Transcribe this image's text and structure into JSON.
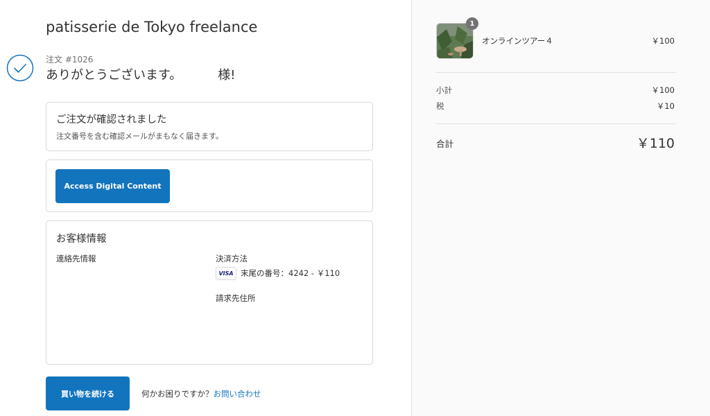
{
  "shop": {
    "name": "patisserie de Tokyo freelance"
  },
  "order": {
    "number_label": "注文 #1026",
    "thanks_prefix": "ありがとうございます。",
    "thanks_suffix": "様!"
  },
  "confirmation": {
    "title": "ご注文が確認されました",
    "subtitle": "注文番号を含む確認メールがまもなく届きます。"
  },
  "digital": {
    "button_label": "Access Digital Content"
  },
  "customer": {
    "title": "お客様情報",
    "contact_label": "連絡先情報",
    "payment_label": "決済方法",
    "card_brand": "VISA",
    "card_text": "末尾の番号：4242 - ￥110",
    "billing_label": "請求先住所"
  },
  "footer": {
    "continue_label": "買い物を続ける",
    "help_text": "何かお困りですか？",
    "contact_link": "お問い合わせ"
  },
  "summary": {
    "item": {
      "name": "オンラインツアー４",
      "price": "￥100",
      "quantity": "1"
    },
    "subtotal_label": "小計",
    "subtotal_value": "￥100",
    "tax_label": "税",
    "tax_value": "￥10",
    "total_label": "合計",
    "total_value": "￥110"
  },
  "colors": {
    "accent": "#1374be",
    "sidebar_bg": "#fafafa",
    "border": "#d9d9d9"
  },
  "icons": {
    "check": "checkmark-circle-icon",
    "card": "visa-card-icon"
  }
}
